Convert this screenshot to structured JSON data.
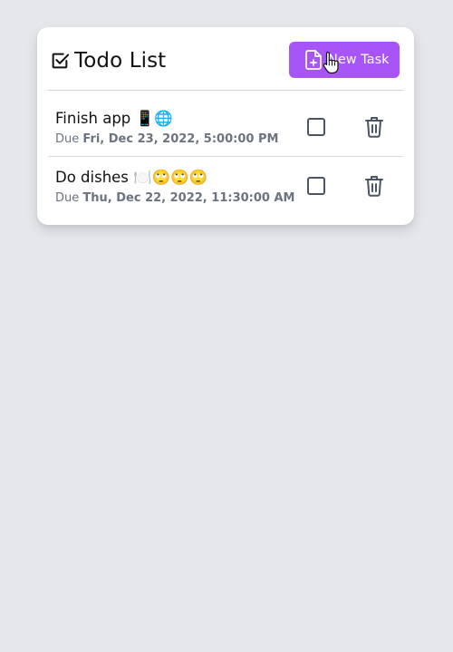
{
  "header": {
    "title": "Todo List",
    "title_icon": "checkbox-check-icon",
    "new_task_label": "New Task",
    "new_task_icon": "file-plus-icon"
  },
  "tasks": [
    {
      "name": "Finish app 📱🌐",
      "due_prefix": "Due",
      "due_date": "Fri, Dec 23, 2022, 5:00:00 PM",
      "completed": false
    },
    {
      "name": "Do dishes 🍽️🙄🙄🙄",
      "due_prefix": "Due",
      "due_date": "Thu, Dec 22, 2022, 11:30:00 AM",
      "completed": false
    }
  ],
  "colors": {
    "background": "#e5e7eb",
    "card": "#ffffff",
    "accent": "#a855f7",
    "muted_text": "#6b7280"
  }
}
